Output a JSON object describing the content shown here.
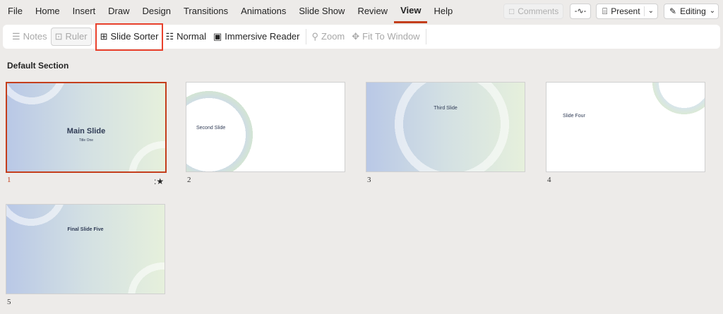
{
  "menu": [
    "File",
    "Home",
    "Insert",
    "Draw",
    "Design",
    "Transitions",
    "Animations",
    "Slide Show",
    "Review",
    "View",
    "Help"
  ],
  "active_menu": "View",
  "top_right": {
    "comments": "Comments",
    "present": "Present",
    "editing": "Editing"
  },
  "ribbon": {
    "notes": "Notes",
    "ruler": "Ruler",
    "slide_sorter": "Slide Sorter",
    "normal": "Normal",
    "immersive_reader": "Immersive Reader",
    "zoom": "Zoom",
    "fit_to_window": "Fit To Window"
  },
  "section": "Default Section",
  "slides": [
    {
      "number": "1",
      "title": "Main Slide",
      "subtitle": "Title One",
      "selected": true,
      "has_animation": true
    },
    {
      "number": "2",
      "title": "Second Slide"
    },
    {
      "number": "3",
      "title": "Third Slide"
    },
    {
      "number": "4",
      "title": "Slide Four"
    },
    {
      "number": "5",
      "title": "Final Slide Five"
    }
  ],
  "colors": {
    "accent": "#c43e1c",
    "highlight": "#e8412c"
  }
}
